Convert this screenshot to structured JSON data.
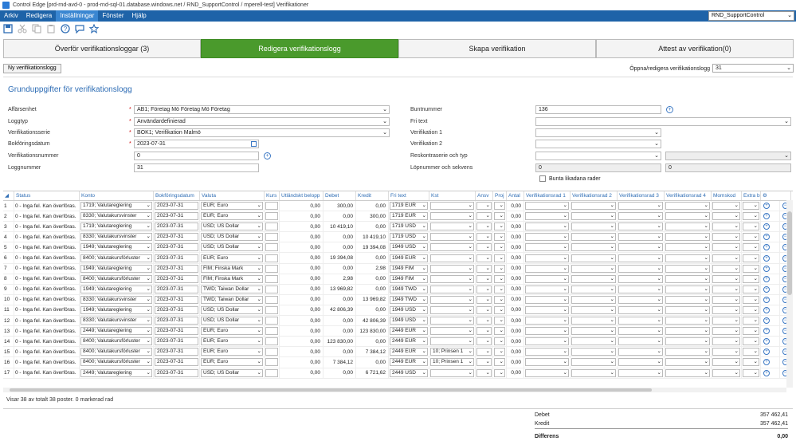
{
  "window": {
    "title": "Control Edge [prd-rnd-avd-0 - prod-rnd-sql-01.database.windows.net / RND_SupportControl / mperell-test] Verifikationer"
  },
  "menu": {
    "items": [
      "Arkiv",
      "Redigera",
      "Inställningar",
      "Fönster",
      "Hjälp"
    ],
    "active_index": 2,
    "database": "RND_SupportControl"
  },
  "toolbar": {
    "icons": [
      "save-icon",
      "cut-icon",
      "copy-icon",
      "paste-icon",
      "help-icon",
      "chat-icon",
      "star-icon"
    ]
  },
  "tabs": [
    {
      "label": "Överför verifikationsloggar (3)"
    },
    {
      "label": "Redigera verifikationslogg"
    },
    {
      "label": "Skapa verifikation"
    },
    {
      "label": "Attest av verifikation(0)"
    }
  ],
  "active_tab": 1,
  "subbar": {
    "new_button": "Ny verifikationslogg",
    "open_label": "Öppna/redigera verifikationslogg",
    "open_value": "31"
  },
  "form": {
    "title": "Grunduppgifter för verifikationslogg",
    "affarsenhet": {
      "label": "Affärsenhet",
      "value": "AB1; Företag Mö Företag Mö Företag"
    },
    "loggtyp": {
      "label": "Loggtyp",
      "value": "Användardefinierad"
    },
    "verifikationsserie": {
      "label": "Verifikationsserie",
      "value": "BOK1; Verifikation Malmö"
    },
    "bokforingsdatum": {
      "label": "Bokföringsdatum",
      "value": "2023-07-31"
    },
    "verifikationsnummer": {
      "label": "Verifikationsnummer",
      "value": "0"
    },
    "loggnummer": {
      "label": "Loggnummer",
      "value": "31"
    },
    "buntnummer": {
      "label": "Buntnummer",
      "value": "136"
    },
    "fritext": {
      "label": "Fri text",
      "value": ""
    },
    "verifikation1": {
      "label": "Verifikation 1",
      "value": ""
    },
    "verifikation2": {
      "label": "Verifikation 2",
      "value": ""
    },
    "reskontraserie": {
      "label": "Reskontraserie och typ",
      "value": ""
    },
    "lopnummer": {
      "label": "Löpnummer och sekvens",
      "value1": "0",
      "value2": "0"
    },
    "bunta": {
      "label": "Bunta likadana rader"
    }
  },
  "grid": {
    "columns": [
      "Status",
      "Konto",
      "Bokföringsdatum",
      "Valuta",
      "Kurs",
      "Utländskt belopp",
      "Debet",
      "Kredit",
      "Fri text",
      "Kst",
      "Ansv",
      "Proj",
      "Antal",
      "Verifikationsrad 1",
      "Verifikationsrad 2",
      "Verifikationsrad 3",
      "Verifikationsrad 4",
      "Momskod",
      "Extra b"
    ],
    "rows": [
      {
        "n": "1",
        "status": "0 - Inga fel. Kan överföras.",
        "konto": "1719; Valutareglering",
        "datum": "2023-07-31",
        "valuta": "EUR; Euro",
        "utl": "0,00",
        "debet": "300,00",
        "kredit": "0,00",
        "fritext": "1719 EUR",
        "kst": "",
        "antal": "0,00"
      },
      {
        "n": "2",
        "status": "0 - Inga fel. Kan överföras.",
        "konto": "8330; Valutakursvinster",
        "datum": "2023-07-31",
        "valuta": "EUR; Euro",
        "utl": "0,00",
        "debet": "0,00",
        "kredit": "300,00",
        "fritext": "1719 EUR",
        "kst": "",
        "antal": "0,00"
      },
      {
        "n": "3",
        "status": "0 - Inga fel. Kan överföras.",
        "konto": "1719; Valutareglering",
        "datum": "2023-07-31",
        "valuta": "USD; US Dollar",
        "utl": "0,00",
        "debet": "10 419,10",
        "kredit": "0,00",
        "fritext": "1719 USD",
        "kst": "",
        "antal": "0,00"
      },
      {
        "n": "4",
        "status": "0 - Inga fel. Kan överföras.",
        "konto": "8330; Valutakursvinster",
        "datum": "2023-07-31",
        "valuta": "USD; US Dollar",
        "utl": "0,00",
        "debet": "0,00",
        "kredit": "10 419,10",
        "fritext": "1719 USD",
        "kst": "",
        "antal": "0,00"
      },
      {
        "n": "5",
        "status": "0 - Inga fel. Kan överföras.",
        "konto": "1949; Valutareglering",
        "datum": "2023-07-31",
        "valuta": "USD; US Dollar",
        "utl": "0,00",
        "debet": "0,00",
        "kredit": "19 394,08",
        "fritext": "1949 USD",
        "kst": "",
        "antal": "0,00"
      },
      {
        "n": "6",
        "status": "0 - Inga fel. Kan överföras.",
        "konto": "8400; Valutakursförluster",
        "datum": "2023-07-31",
        "valuta": "EUR; Euro",
        "utl": "0,00",
        "debet": "19 394,08",
        "kredit": "0,00",
        "fritext": "1949 EUR",
        "kst": "",
        "antal": "0,00"
      },
      {
        "n": "7",
        "status": "0 - Inga fel. Kan överföras.",
        "konto": "1949; Valutareglering",
        "datum": "2023-07-31",
        "valuta": "FIM; Finska Mark",
        "utl": "0,00",
        "debet": "0,00",
        "kredit": "2,98",
        "fritext": "1949 FIM",
        "kst": "",
        "antal": "0,00"
      },
      {
        "n": "8",
        "status": "0 - Inga fel. Kan överföras.",
        "konto": "8400; Valutakursförluster",
        "datum": "2023-07-31",
        "valuta": "FIM; Finska Mark",
        "utl": "0,00",
        "debet": "2,98",
        "kredit": "0,00",
        "fritext": "1949 FIM",
        "kst": "",
        "antal": "0,00"
      },
      {
        "n": "9",
        "status": "0 - Inga fel. Kan överföras.",
        "konto": "1949; Valutareglering",
        "datum": "2023-07-31",
        "valuta": "TWD; Taiwan Dollar",
        "utl": "0,00",
        "debet": "13 969,82",
        "kredit": "0,00",
        "fritext": "1949 TWD",
        "kst": "",
        "antal": "0,00"
      },
      {
        "n": "10",
        "status": "0 - Inga fel. Kan överföras.",
        "konto": "8330; Valutakursvinster",
        "datum": "2023-07-31",
        "valuta": "TWD; Taiwan Dollar",
        "utl": "0,00",
        "debet": "0,00",
        "kredit": "13 969,82",
        "fritext": "1949 TWD",
        "kst": "",
        "antal": "0,00"
      },
      {
        "n": "11",
        "status": "0 - Inga fel. Kan överföras.",
        "konto": "1949; Valutareglering",
        "datum": "2023-07-31",
        "valuta": "USD; US Dollar",
        "utl": "0,00",
        "debet": "42 806,39",
        "kredit": "0,00",
        "fritext": "1949 USD",
        "kst": "",
        "antal": "0,00"
      },
      {
        "n": "12",
        "status": "0 - Inga fel. Kan överföras.",
        "konto": "8330; Valutakursvinster",
        "datum": "2023-07-31",
        "valuta": "USD; US Dollar",
        "utl": "0,00",
        "debet": "0,00",
        "kredit": "42 806,39",
        "fritext": "1949 USD",
        "kst": "",
        "antal": "0,00"
      },
      {
        "n": "13",
        "status": "0 - Inga fel. Kan överföras.",
        "konto": "2449; Valutareglering",
        "datum": "2023-07-31",
        "valuta": "EUR; Euro",
        "utl": "0,00",
        "debet": "0,00",
        "kredit": "123 830,00",
        "fritext": "2449 EUR",
        "kst": "",
        "antal": "0,00"
      },
      {
        "n": "14",
        "status": "0 - Inga fel. Kan överföras.",
        "konto": "8400; Valutakursförluster",
        "datum": "2023-07-31",
        "valuta": "EUR; Euro",
        "utl": "0,00",
        "debet": "123 830,00",
        "kredit": "0,00",
        "fritext": "2449 EUR",
        "kst": "",
        "antal": "0,00"
      },
      {
        "n": "15",
        "status": "0 - Inga fel. Kan överföras.",
        "konto": "8400; Valutakursförluster",
        "datum": "2023-07-31",
        "valuta": "EUR; Euro",
        "utl": "0,00",
        "debet": "0,00",
        "kredit": "7 384,12",
        "fritext": "2449 EUR",
        "kst": "10; Prinsen 1",
        "antal": "0,00"
      },
      {
        "n": "16",
        "status": "0 - Inga fel. Kan överföras.",
        "konto": "8400; Valutakursförluster",
        "datum": "2023-07-31",
        "valuta": "EUR; Euro",
        "utl": "0,00",
        "debet": "7 384,12",
        "kredit": "0,00",
        "fritext": "2449 EUR",
        "kst": "10; Prinsen 1",
        "antal": "0,00"
      },
      {
        "n": "17",
        "status": "0 - Inga fel. Kan överföras.",
        "konto": "2449; Valutareglering",
        "datum": "2023-07-31",
        "valuta": "USD; US Dollar",
        "utl": "0,00",
        "debet": "0,00",
        "kredit": "6 721,62",
        "fritext": "2449 USD",
        "kst": "",
        "antal": "0,00"
      }
    ]
  },
  "status_line": "Visar 38 av totalt 38 poster. 0 markerad rad",
  "totals": {
    "debet_label": "Debet",
    "debet": "357 462,41",
    "kredit_label": "Kredit",
    "kredit": "357 462,41",
    "diff_label": "Differens",
    "diff": "0,00"
  }
}
